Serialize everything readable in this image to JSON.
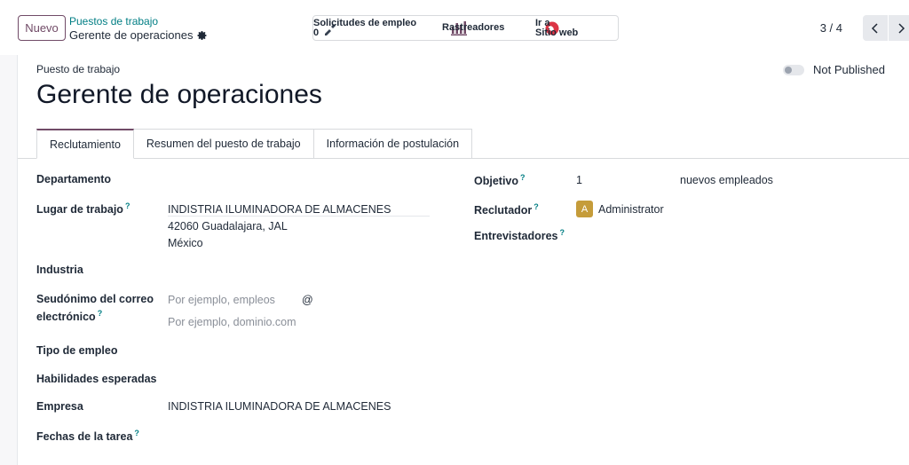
{
  "control_panel": {
    "new_button": "Nuevo",
    "breadcrumb_parent": "Puestos de trabajo",
    "breadcrumb_current": "Gerente de operaciones",
    "smart_buttons": [
      {
        "label": "Solicitudes de empleo",
        "value": "0",
        "icon": "puzzle-icon"
      },
      {
        "label": "Rastreadores",
        "icon": "bar-chart-icon"
      },
      {
        "label": "Ir a",
        "value": "Sitio web",
        "icon": "globe-icon"
      }
    ],
    "pager": "3 / 4"
  },
  "form": {
    "header_label": "Puesto de trabajo",
    "title": "Gerente de operaciones",
    "publish_status": "Not Published",
    "tabs": [
      "Reclutamiento",
      "Resumen del puesto de trabajo",
      "Información de postulación"
    ],
    "left_fields": {
      "department_label": "Departamento",
      "workplace_label": "Lugar de trabajo",
      "workplace_name": "INDISTRIA ILUMINADORA DE ALMACENES",
      "workplace_line2": "42060 Guadalajara, JAL",
      "workplace_line3": "México",
      "industry_label": "Industria",
      "alias_label_1": "Seudónimo del correo",
      "alias_label_2": "electrónico",
      "alias_placeholder": "Por ejemplo, empleos",
      "alias_at": "@",
      "domain_placeholder": "Por ejemplo, dominio.com",
      "employment_type_label": "Tipo de empleo",
      "skills_label": "Habilidades esperadas",
      "company_label": "Empresa",
      "company_value": "INDISTRIA ILUMINADORA DE ALMACENES",
      "task_dates_label": "Fechas de la tarea"
    },
    "right_fields": {
      "target_label": "Objetivo",
      "target_value": "1",
      "target_suffix": "nuevos empleados",
      "recruiter_label": "Reclutador",
      "recruiter_avatar": "A",
      "recruiter_name": "Administrator",
      "interviewers_label": "Entrevistadores"
    },
    "help_marker": "?"
  }
}
